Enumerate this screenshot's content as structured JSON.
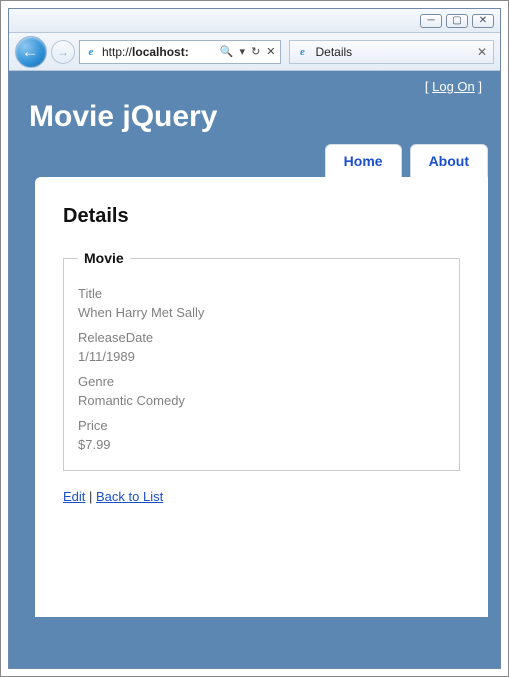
{
  "window": {
    "minimize_glyph": "─",
    "maximize_glyph": "▢",
    "close_glyph": "✕"
  },
  "browser": {
    "back_glyph": "←",
    "forward_glyph": "→",
    "url_prefix": "http://",
    "url_host": "localhost:",
    "search_glyph": "🔍",
    "refresh_glyph": "↻",
    "stop_glyph": "✕",
    "tab_title": "Details",
    "tab_close_glyph": "✕",
    "ie_glyph": "e"
  },
  "header": {
    "logon_prefix": "[ ",
    "logon_label": "Log On",
    "logon_suffix": " ]",
    "site_title": "Movie jQuery"
  },
  "menu": {
    "home": "Home",
    "about": "About"
  },
  "page": {
    "heading": "Details",
    "legend": "Movie",
    "fields": [
      {
        "label": "Title",
        "value": "When Harry Met Sally"
      },
      {
        "label": "ReleaseDate",
        "value": "1/11/1989"
      },
      {
        "label": "Genre",
        "value": "Romantic Comedy"
      },
      {
        "label": "Price",
        "value": "$7.99"
      }
    ],
    "edit_label": "Edit",
    "separator": " | ",
    "back_label": "Back to List"
  }
}
